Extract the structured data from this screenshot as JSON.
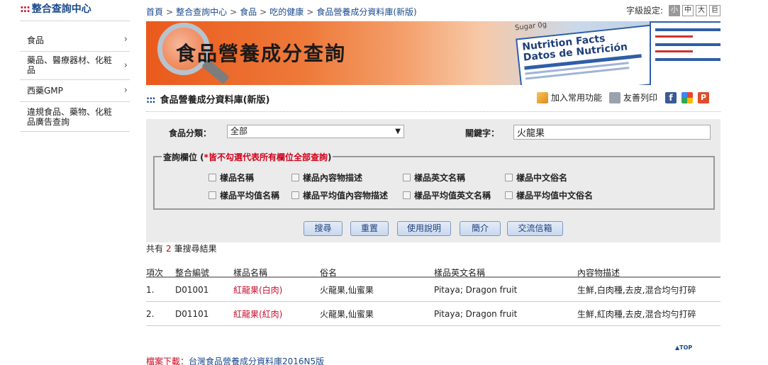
{
  "sidebar": {
    "title": "整合查詢中心",
    "title_prefix": ":::",
    "items": [
      {
        "label": "食品"
      },
      {
        "label": "藥品、醫療器材、化粧品"
      },
      {
        "label": "西藥GMP"
      },
      {
        "label": "違規食品、藥物、化粧品廣告查詢"
      }
    ]
  },
  "breadcrumb": [
    "首頁",
    "整合查詢中心",
    "食品",
    "吃的健康",
    "食品營養成分資料庫(新版)"
  ],
  "breadcrumb_sep": ">",
  "font_size": {
    "label": "字級設定:",
    "options": [
      "小",
      "中",
      "大",
      "巨"
    ],
    "selected": "小"
  },
  "banner": {
    "title": "食品營養成分查詢",
    "label_text": "Nutrition Facts",
    "label_text2": "Datos de Nutrición",
    "sugar": "Sugar 0g"
  },
  "section": {
    "prefix": ":::",
    "title": "食品營養成分資料庫(新版)",
    "add_favorite": "加入常用功能",
    "print": "友善列印"
  },
  "search": {
    "category_label": "食品分類：",
    "category_value": "全部",
    "keyword_label": "關鍵字：",
    "keyword_value": "火龍果",
    "fieldset_label": "查詢欄位 (",
    "fieldset_warning": "*皆不勾選代表所有欄位全部查詢",
    "fieldset_close": ")",
    "checkboxes": [
      "樣品名稱",
      "樣品內容物描述",
      "樣品英文名稱",
      "樣品中文俗名",
      "樣品平均值名稱",
      "樣品平均值內容物描述",
      "樣品平均值英文名稱",
      "樣品平均值中文俗名"
    ],
    "buttons": [
      "搜尋",
      "重置",
      "使用說明",
      "簡介",
      "交流信箱"
    ]
  },
  "results": {
    "prefix": "共有",
    "count": "2",
    "suffix": "筆搜尋結果",
    "headers": [
      "項次",
      "整合編號",
      "樣品名稱",
      "俗名",
      "樣品英文名稱",
      "內容物描述"
    ],
    "rows": [
      [
        "1.",
        "D01001",
        "紅龍果(白肉)",
        "火龍果,仙蜜果",
        "Pitaya; Dragon fruit",
        "生鮮,白肉種,去皮,混合均勻打碎"
      ],
      [
        "2.",
        "D01101",
        "紅龍果(紅肉)",
        "火龍果,仙蜜果",
        "Pitaya; Dragon fruit",
        "生鮮,紅肉種,去皮,混合均勻打碎"
      ]
    ]
  },
  "to_top": "▲TOP",
  "download": {
    "label": "檔案下載：",
    "link": "台灣食品營養成分資料庫2016N5版"
  }
}
